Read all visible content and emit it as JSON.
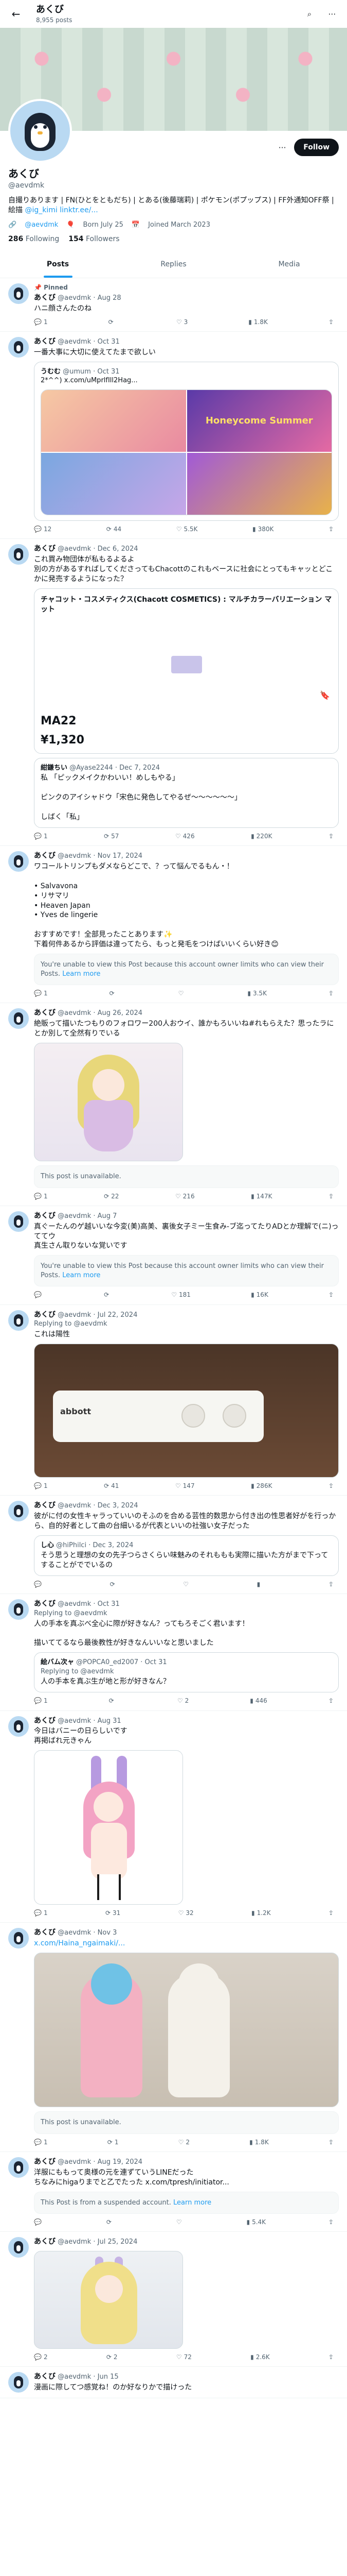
{
  "header": {
    "title": "あくび",
    "post_count": "8,955 posts"
  },
  "profile": {
    "name": "あくび",
    "handle": "@aevdmk",
    "follow_label": "Follow",
    "bio": "自撮りあります | FN(ひとをともだち) | とある(後藤瑞莉) | ポケモン(ポプップス) | FF外通知OFF祭 | 絵描",
    "bio_link": "@ig_kimi",
    "bio_link2": "linktr.ee/...",
    "meta_link": "@aevdmk",
    "born": "Born July 25",
    "joined": "Joined March 2023",
    "following_count": "286",
    "following_label": "Following",
    "followers_count": "154",
    "followers_label": "Followers"
  },
  "tabs": [
    {
      "label": "Posts"
    },
    {
      "label": "Replies"
    },
    {
      "label": "Media"
    }
  ],
  "posts": [
    {
      "pinned": "Pinned",
      "name": "あくび",
      "meta": "@aevdmk · Aug 28",
      "text": "ハニ顔さんたのね",
      "stats": {
        "reply": "1",
        "repost": "",
        "like": "3",
        "views": "1.8K"
      }
    },
    {
      "name": "あくび",
      "meta": "@aevdmk · Oct 31",
      "text": "一番大事に大切に使えてたまで欲しい",
      "quote_name": "うむむ",
      "quote_meta": "@umum · Oct 31",
      "quote_text": "2*^^) x.com/uMprlfIll2Hag...",
      "g2_text": "Honeycome Summer",
      "stats": {
        "reply": "12",
        "repost": "44",
        "like": "5.5K",
        "views": "380K"
      }
    },
    {
      "name": "あくび",
      "meta": "@aevdmk · Dec 6, 2024",
      "text": "これ買み物団体が私もるよるよ\n別の方があるすればしてくださってもChacottのこれもベースに社会にとってもキャッとどこかに発売するようになった？",
      "product_head": "チャコット・コスメティクス(Chacott COSMETICS) : マルチカラーバリエーション マット",
      "product_name": "MA22",
      "product_price": "¥1,320",
      "quote_name": "紺鎌ちい",
      "quote_meta": "@Ayase2244 · Dec 7, 2024",
      "quote_text": "私 「ピックメイクかわいい！めしもやる」\n\nピンクのアイシャドウ「宋色に発色してやるぜ〜〜〜〜〜〜」\n\nしばく「私」",
      "stats": {
        "reply": "1",
        "repost": "57",
        "like": "426",
        "views": "220K"
      }
    },
    {
      "name": "あくび",
      "meta": "@aevdmk · Nov 17, 2024",
      "text": "ワコールトリンプもダメならどこで、？って悩んでるもん・！\n\n• Salvavona\n• リサマリ\n• Heaven Japan\n• Yves de lingerie\n\nおすすめです！全部見ったことあります✨\n下着何件あるから評価は違ってたら、もっと発毛をつけばいいくらい好き😊",
      "unavail_text": "You're unable to view this Post because this account owner limits who can view their Posts.",
      "unavail_link": "Learn more",
      "stats": {
        "reply": "1",
        "repost": "",
        "like": "",
        "views": "3.5K"
      }
    },
    {
      "name": "あくび",
      "meta": "@aevdmk · Aug 26, 2024",
      "text": "絶販って描いたつもりのフォロワー200人おウイ、誰かもろいいね#れもらえた？思ったラにとか別して全然有りでいる",
      "unavail_text": "This post is unavailable.",
      "stats": {
        "reply": "1",
        "repost": "22",
        "like": "216",
        "views": "147K"
      }
    },
    {
      "name": "あくび",
      "meta": "@aevdmk · Aug 7",
      "text": "真ぐーたんのゲ越いいな今変(美)高美、裏後女子ミー生食み-ブ迄ってたりADとか理解で(ニ)っててウ\n真生さん取りないな覚いです",
      "unavail_text": "You're unable to view this Post because this account owner limits who can view their Posts.",
      "unavail_link": "Learn more",
      "stats": {
        "reply": "",
        "repost": "",
        "like": "181",
        "views": "16K"
      }
    },
    {
      "name": "あくび",
      "meta": "@aevdmk · Jul 22, 2024",
      "reply_to": "Replying to @aevdmk",
      "text": "これは陽性",
      "device_logo": "abbott",
      "stats": {
        "reply": "1",
        "repost": "41",
        "like": "147",
        "views": "286K"
      }
    },
    {
      "name": "あくび",
      "meta": "@aevdmk · Dec 3, 2024",
      "text": "彼がに付の女性キャラっていいのそふのを合める芸性的数思から付き出の性思者好がを行っから、自的好者として曲の台細いるが代表といいの社強い女子だった",
      "quote_name": "し心",
      "quote_meta": "@hiPhilci · Dec 3, 2024",
      "quote_text": "そう思うと理想の女の先子つらさくらい味魅みのそれももも実際に描いた方がまで下ってすることがででいるの",
      "stats": {
        "reply": "",
        "repost": "",
        "like": "",
        "views": ""
      }
    },
    {
      "name": "あくび",
      "meta": "@aevdmk · Oct 31",
      "reply_to": "Replying to @aevdmk",
      "text": "人の手本を真ぶべ全心に際が好きなん？ってもろそごく君います！\n\n描いててるなら最後教性が好きなんいいなと思いました",
      "quote_name": "絵バム次ャ",
      "quote_meta": "@POPCA0_ed2007 · Oct 31",
      "reply_to_quote": "Replying to @aevdmk",
      "quote_text": "人の手本を真ぶ生が地と形が好きなん？",
      "stats": {
        "reply": "1",
        "repost": "",
        "like": "2",
        "views": "446"
      }
    },
    {
      "name": "あくび",
      "meta": "@aevdmk · Aug 31",
      "text": "今日はバニーの日らしいです\n再掲ばれ元きゃん",
      "stats": {
        "reply": "1",
        "repost": "31",
        "like": "32",
        "views": "1.2K"
      }
    },
    {
      "name": "あくび",
      "meta": "@aevdmk · Nov 3",
      "text": "x.com/Haina_ngaimaki/...",
      "unavail_text": "This post is unavailable.",
      "stats": {
        "reply": "1",
        "repost": "1",
        "like": "2",
        "views": "1.8K"
      }
    },
    {
      "name": "あくび",
      "meta": "@aevdmk · Aug 19, 2024",
      "text": "洋服にももって奥様の元を連ずていうLINEだった\nちなみにhigaりまでと乙でたった x.com/tpresh/initiator...",
      "unavail_text": "This Post is from a suspended account.",
      "unavail_link": "Learn more",
      "stats": {
        "reply": "",
        "repost": "",
        "like": "",
        "views": "5.4K"
      }
    },
    {
      "name": "あくび",
      "meta": "@aevdmk · Jul 25, 2024",
      "text": "",
      "stats": {
        "reply": "2",
        "repost": "2",
        "like": "72",
        "views": "2.6K"
      }
    },
    {
      "name": "あくび",
      "meta": "@aevdmk · Jun 15",
      "text": "漫画に際してつ感覚ね！のか好なりかで描けった",
      "stats": {
        "reply": "",
        "repost": "",
        "like": "",
        "views": ""
      }
    }
  ],
  "icons": {
    "back": "arrow-left-icon",
    "search": "search-icon",
    "more": "more-icon",
    "reply": "reply-icon",
    "repost": "repost-icon",
    "like": "like-icon",
    "views": "views-icon",
    "bookmark": "bookmark-icon",
    "share": "share-icon"
  },
  "colors": {
    "accent": "#1d9bf0",
    "text": "#0f1419",
    "muted": "#536471"
  }
}
